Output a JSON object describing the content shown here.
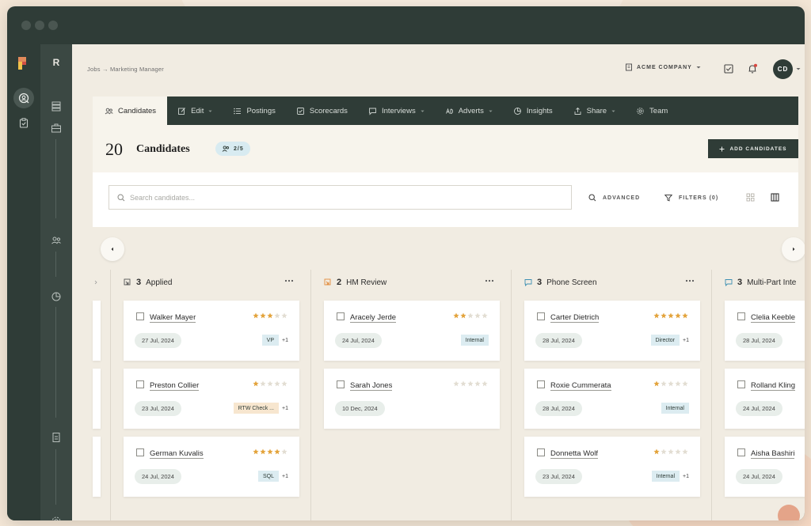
{
  "breadcrumb": {
    "root": "Jobs",
    "sep": "→",
    "current": "Marketing Manager"
  },
  "sidebar": {
    "letter": "R"
  },
  "header": {
    "company": "ACME COMPANY",
    "avatar_initials": "CD"
  },
  "tabs": [
    {
      "label": "Candidates",
      "icon": "users-icon"
    },
    {
      "label": "Edit",
      "icon": "edit-icon"
    },
    {
      "label": "Postings",
      "icon": "list-icon"
    },
    {
      "label": "Scorecards",
      "icon": "scorecard-icon"
    },
    {
      "label": "Interviews",
      "icon": "chat-icon"
    },
    {
      "label": "Adverts",
      "icon": "advert-icon"
    },
    {
      "label": "Insights",
      "icon": "pie-icon"
    },
    {
      "label": "Share",
      "icon": "share-icon"
    },
    {
      "label": "Team",
      "icon": "gear-icon"
    }
  ],
  "summary": {
    "count": "20",
    "label": "Candidates",
    "badge": "2/5",
    "add_button": "ADD CANDIDATES"
  },
  "search": {
    "placeholder": "Search candidates...",
    "advanced": "ADVANCED",
    "filters": "FILTERS (0)"
  },
  "columns": [
    {
      "count": "3",
      "title": "Applied",
      "cards": [
        {
          "name": "Walker Mayer",
          "rating": 3,
          "date": "27 Jul, 2024",
          "tag": "VP",
          "extra": "+1"
        },
        {
          "name": "Preston Collier",
          "rating": 1,
          "date": "23 Jul, 2024",
          "tag": "RTW Check ...",
          "extra": "+1"
        },
        {
          "name": "German Kuvalis",
          "rating": 4,
          "date": "24 Jul, 2024",
          "tag": "SQL",
          "extra": "+1"
        }
      ]
    },
    {
      "count": "2",
      "title": "HM Review",
      "cards": [
        {
          "name": "Aracely Jerde",
          "rating": 2,
          "date": "24 Jul, 2024",
          "tag": "Internal",
          "extra": ""
        },
        {
          "name": "Sarah Jones",
          "rating": 0,
          "date": "10 Dec, 2024",
          "tag": "",
          "extra": ""
        }
      ]
    },
    {
      "count": "3",
      "title": "Phone Screen",
      "cards": [
        {
          "name": "Carter Dietrich",
          "rating": 5,
          "date": "28 Jul, 2024",
          "tag": "Director",
          "extra": "+1"
        },
        {
          "name": "Roxie Cummerata",
          "rating": 1,
          "date": "28 Jul, 2024",
          "tag": "Internal",
          "extra": ""
        },
        {
          "name": "Donnetta Wolf",
          "rating": 1,
          "date": "23 Jul, 2024",
          "tag": "Internal",
          "extra": "+1"
        }
      ]
    },
    {
      "count": "3",
      "title": "Multi-Part Inte",
      "cards": [
        {
          "name": "Clelia Keeble",
          "rating": 0,
          "date": "28 Jul, 2024",
          "tag": "",
          "extra": ""
        },
        {
          "name": "Rolland Kling",
          "rating": 0,
          "date": "24 Jul, 2024",
          "tag": "",
          "extra": ""
        },
        {
          "name": "Aisha Bashiri",
          "rating": 0,
          "date": "24 Jul, 2024",
          "tag": "",
          "extra": ""
        }
      ]
    }
  ],
  "colors": {
    "primary": "#2f3c37",
    "star_on": "#e3a33b",
    "star_off": "#e2ddd2",
    "tag_blue": "#dcecf1",
    "tag_warn": "#f7e6cf"
  }
}
